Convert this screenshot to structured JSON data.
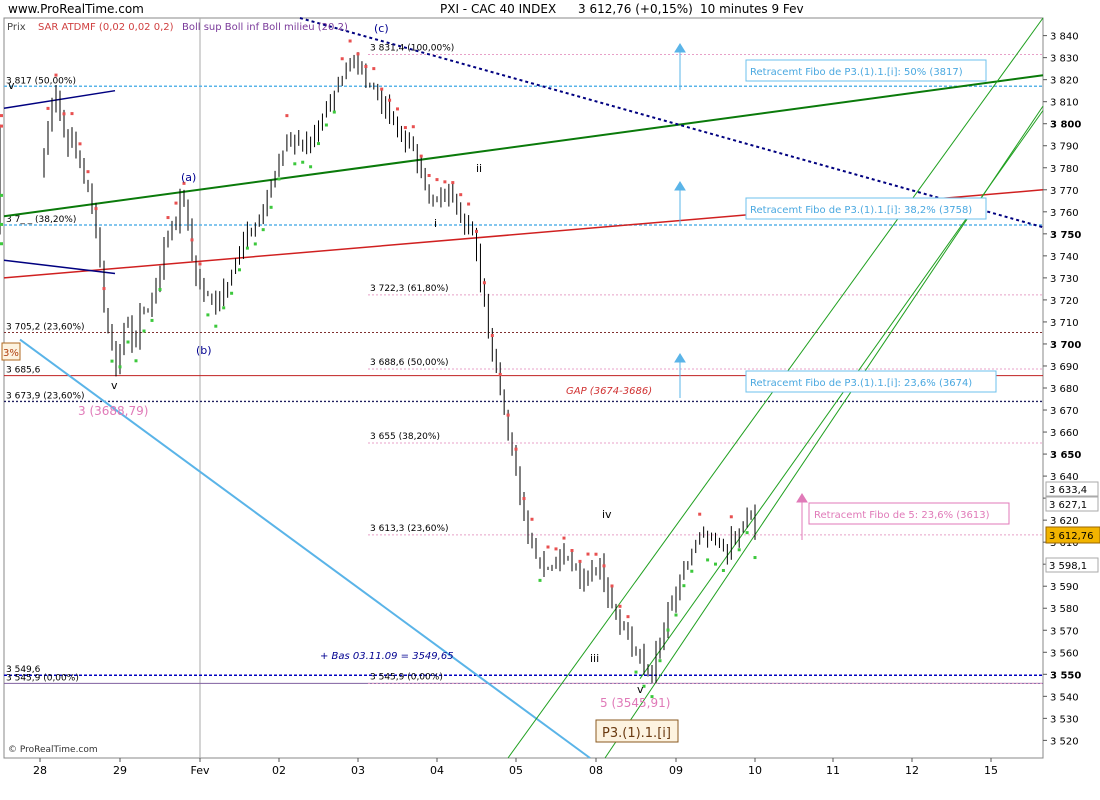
{
  "header": {
    "site": "www.ProRealTime.com",
    "title": "PXI - CAC 40 INDEX",
    "last": "3 612,76 (+0,15%)",
    "period": "10 minutes  9 Fev"
  },
  "legend": {
    "prix": "Prix",
    "sar": "SAR ATDMF (0,02 0,02 0,2)",
    "boll": "Boll sup Boll inf Boll milieu (20 2)"
  },
  "copyright": "© ProRealTime.com",
  "colors": {
    "candle": "#000000",
    "sar_red": "#e85050",
    "sar_green": "#3cc83c",
    "boll_fill": "#f0d8ee",
    "boll_line": "#7a3a9a",
    "green_line": "#0a7a0a",
    "red_line": "#d02020",
    "navy_line": "#000080",
    "cyan_line": "#5ab4e8",
    "channel": "#20a020",
    "pink": "#e07ab8",
    "fibo_label": "#4aa8e0"
  },
  "chart_data": {
    "type": "candlestick",
    "instrument": "PXI - CAC 40 INDEX",
    "timeframe": "10 minutes",
    "ylim": [
      3512,
      3848
    ],
    "y_ticks": [
      3520,
      3530,
      3540,
      3550,
      3560,
      3570,
      3580,
      3590,
      3600,
      3610,
      3620,
      3630,
      3640,
      3650,
      3660,
      3670,
      3680,
      3690,
      3700,
      3710,
      3720,
      3730,
      3740,
      3750,
      3760,
      3770,
      3780,
      3790,
      3800,
      3810,
      3820,
      3830,
      3840
    ],
    "y_tick_labels": [
      "3 520",
      "3 530",
      "3 540",
      "3 550",
      "3 560",
      "3 570",
      "3 580",
      "3 590",
      "3 600",
      "3 610",
      "3 620",
      "3 630",
      "3 640",
      "3 650",
      "3 660",
      "3 670",
      "3 680",
      "3 690",
      "3 700",
      "3 710",
      "3 720",
      "3 730",
      "3 740",
      "3 750",
      "3 760",
      "3 770",
      "3 780",
      "3 790",
      "3 800",
      "3 810",
      "3 820",
      "3 830",
      "3 840"
    ],
    "x_labels": [
      "28",
      "29",
      "Fev",
      "02",
      "03",
      "04",
      "05",
      "08",
      "09",
      "10",
      "11",
      "12",
      "15"
    ],
    "price_path": [
      [
        0,
        3790
      ],
      [
        0.3,
        3800
      ],
      [
        0.6,
        3765
      ],
      [
        0.9,
        3755
      ],
      [
        1.2,
        3770
      ],
      [
        1.6,
        3800
      ],
      [
        2.0,
        3815
      ],
      [
        2.3,
        3790
      ],
      [
        2.6,
        3795
      ],
      [
        3.0,
        3775
      ],
      [
        3.3,
        3770
      ],
      [
        3.7,
        3730
      ],
      [
        4.0,
        3705
      ],
      [
        4.3,
        3690
      ],
      [
        4.7,
        3712
      ],
      [
        5.0,
        3700
      ],
      [
        5.4,
        3715
      ],
      [
        5.8,
        3720
      ],
      [
        6.2,
        3745
      ],
      [
        6.6,
        3755
      ],
      [
        7.0,
        3768
      ],
      [
        7.3,
        3740
      ],
      [
        7.7,
        3725
      ],
      [
        8.1,
        3718
      ],
      [
        8.5,
        3722
      ],
      [
        8.9,
        3735
      ],
      [
        9.3,
        3742
      ],
      [
        9.7,
        3752
      ],
      [
        10.1,
        3758
      ],
      [
        10.5,
        3770
      ],
      [
        10.9,
        3788
      ],
      [
        11.3,
        3795
      ],
      [
        11.7,
        3790
      ],
      [
        12.1,
        3785
      ],
      [
        12.5,
        3800
      ],
      [
        12.9,
        3812
      ],
      [
        13.3,
        3820
      ],
      [
        13.6,
        3828
      ],
      [
        14.0,
        3825
      ],
      [
        14.3,
        3822
      ],
      [
        14.7,
        3815
      ],
      [
        15.0,
        3810
      ],
      [
        15.4,
        3800
      ],
      [
        15.8,
        3795
      ],
      [
        16.2,
        3788
      ],
      [
        16.6,
        3780
      ],
      [
        17.0,
        3762
      ],
      [
        17.4,
        3766
      ],
      [
        17.8,
        3768
      ],
      [
        18.2,
        3762
      ],
      [
        18.6,
        3752
      ],
      [
        19.0,
        3730
      ],
      [
        19.4,
        3700
      ],
      [
        19.8,
        3680
      ],
      [
        20.2,
        3655
      ],
      [
        20.6,
        3630
      ],
      [
        21.0,
        3612
      ],
      [
        21.4,
        3602
      ],
      [
        21.8,
        3598
      ],
      [
        22.2,
        3605
      ],
      [
        22.6,
        3600
      ],
      [
        23.0,
        3590
      ],
      [
        23.4,
        3600
      ],
      [
        23.8,
        3598
      ],
      [
        24.2,
        3585
      ],
      [
        24.6,
        3575
      ],
      [
        25.0,
        3565
      ],
      [
        25.4,
        3555
      ],
      [
        25.8,
        3550
      ],
      [
        26.2,
        3565
      ],
      [
        26.6,
        3580
      ],
      [
        27.0,
        3592
      ],
      [
        27.4,
        3605
      ],
      [
        27.8,
        3612
      ],
      [
        28.2,
        3610
      ],
      [
        28.6,
        3606
      ],
      [
        29.0,
        3608
      ],
      [
        29.4,
        3615
      ],
      [
        29.8,
        3624
      ],
      [
        30.0,
        3612
      ]
    ],
    "horizontal_levels": [
      {
        "value": 3817,
        "label": "3 817 (50,00%)"
      },
      {
        "value": 3754,
        "label": "3 7_ _ (38,20%)"
      },
      {
        "value": 3705.2,
        "label": "3 705,2 (23,60%)"
      },
      {
        "value": 3685.6,
        "label": "3 685,6"
      },
      {
        "value": 3673.9,
        "label": "3 673,9 (23,60%)"
      },
      {
        "value": 3549.6,
        "label": "3 549,6"
      },
      {
        "value": 3545.9,
        "label": "3 545,9 (0,00%)"
      }
    ],
    "fibo_levels": [
      {
        "value": 3831.4,
        "label": "3 831,4 (100,00%)"
      },
      {
        "value": 3722.3,
        "label": "3 722,3 (61,80%)"
      },
      {
        "value": 3688.6,
        "label": "3 688,6 (50,00%)"
      },
      {
        "value": 3655,
        "label": "3 655 (38,20%)"
      },
      {
        "value": 3613.3,
        "label": "3 613,3 (23,60%)"
      },
      {
        "value": 3545.9,
        "label": "3 545,9 (0,00%)"
      }
    ],
    "annotations": {
      "gap": "GAP (3674-3686)",
      "bas": "+ Bas 03.11.09 = 3549,65",
      "wave3": "3 (3688,79)",
      "wave5": "5 (3545,91)",
      "p3": "P3.(1).1.[i]",
      "box1": "Retracemt Fibo de P3.(1).1.[i]: 50% (3817)",
      "box2": "Retracemt Fibo de P3.(1).1.[i]: 38,2% (3758)",
      "box3": "Retracemt Fibo de P3.(1).1.[i]: 23,6% (3674)",
      "box4": "Retracemt Fibo de 5: 23,6% (3613)",
      "pct": "3%",
      "wave_a": "(a)",
      "wave_b": "(b)",
      "wave_c": "(c)",
      "w_v1": "v",
      "w_v2": "v",
      "w_i": "i",
      "w_ii": "ii",
      "w_iii": "iii",
      "w_iv": "iv",
      "w_v3": "v",
      "w_iv_small": "iv"
    },
    "price_tags": {
      "current": "3 612,76",
      "t1": "3 633,4",
      "t2": "3 627,1",
      "t3": "3 598,1"
    }
  }
}
